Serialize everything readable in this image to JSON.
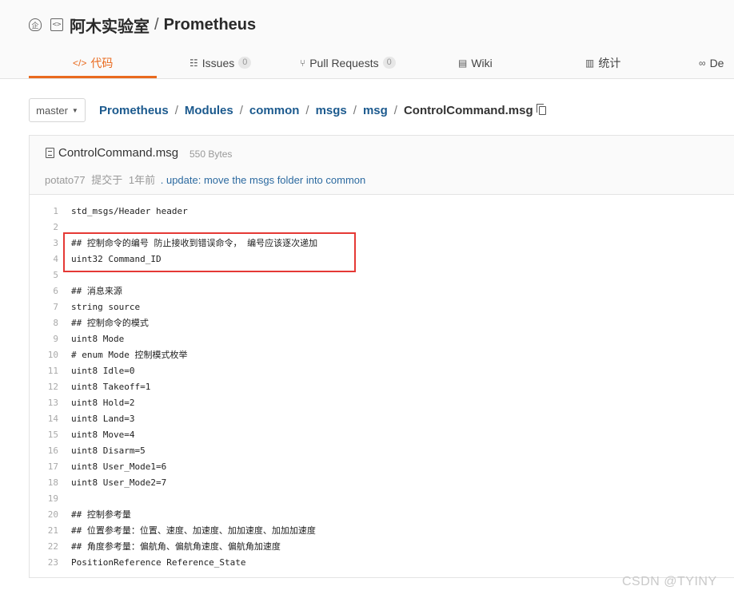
{
  "header": {
    "owner": "阿木实验室",
    "separator": "/",
    "repo": "Prometheus",
    "enterprise_icon_glyph": "企",
    "repo_icon_glyph": "<>"
  },
  "tabs": [
    {
      "icon_glyph": "</>",
      "label": "代码",
      "active": true
    },
    {
      "icon_glyph": "☷",
      "label": "Issues",
      "count": "0"
    },
    {
      "icon_glyph": "⑂",
      "label": "Pull Requests",
      "count": "0"
    },
    {
      "icon_glyph": "▤",
      "label": "Wiki"
    },
    {
      "icon_glyph": "▥",
      "label": "统计"
    },
    {
      "icon_glyph": "∞",
      "label": "De"
    }
  ],
  "accent_color": "#e96a1e",
  "link_color": "#1c5a8e",
  "branch": {
    "label": "master",
    "caret": "▼"
  },
  "breadcrumb": [
    "Prometheus",
    "Modules",
    "common",
    "msgs",
    "msg",
    "ControlCommand.msg"
  ],
  "breadcrumb_sep": "/",
  "file": {
    "name": "ControlCommand.msg",
    "size": "550 Bytes",
    "commit": {
      "author": "potato77",
      "action": "提交于",
      "time": "1年前",
      "message": ". update: move the msgs folder into common"
    }
  },
  "code_lines": [
    {
      "n": "1",
      "text": "std_msgs/Header header"
    },
    {
      "n": "2",
      "text": ""
    },
    {
      "n": "3",
      "text": "## 控制命令的编号 防止接收到错误命令， 编号应该逐次递加"
    },
    {
      "n": "4",
      "text": "uint32 Command_ID"
    },
    {
      "n": "5",
      "text": ""
    },
    {
      "n": "6",
      "text": "## 消息来源"
    },
    {
      "n": "7",
      "text": "string source"
    },
    {
      "n": "8",
      "text": "## 控制命令的模式"
    },
    {
      "n": "9",
      "text": "uint8 Mode"
    },
    {
      "n": "10",
      "text": "# enum Mode 控制模式枚举"
    },
    {
      "n": "11",
      "text": "uint8 Idle=0"
    },
    {
      "n": "12",
      "text": "uint8 Takeoff=1"
    },
    {
      "n": "13",
      "text": "uint8 Hold=2"
    },
    {
      "n": "14",
      "text": "uint8 Land=3"
    },
    {
      "n": "15",
      "text": "uint8 Move=4"
    },
    {
      "n": "16",
      "text": "uint8 Disarm=5"
    },
    {
      "n": "17",
      "text": "uint8 User_Mode1=6"
    },
    {
      "n": "18",
      "text": "uint8 User_Mode2=7"
    },
    {
      "n": "19",
      "text": ""
    },
    {
      "n": "20",
      "text": "## 控制参考量"
    },
    {
      "n": "21",
      "text": "## 位置参考量：位置、速度、加速度、加加速度、加加加速度"
    },
    {
      "n": "22",
      "text": "## 角度参考量：偏航角、偏航角速度、偏航角加速度"
    },
    {
      "n": "23",
      "text": "PositionReference Reference_State"
    }
  ],
  "highlight_color": "#e53935",
  "watermark": "CSDN @TYINY"
}
